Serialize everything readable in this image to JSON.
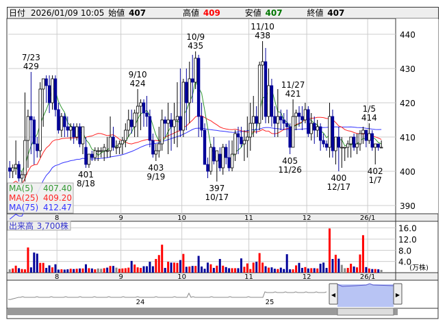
{
  "header": {
    "date_label": "日付",
    "datetime": "2026/01/09 10:05",
    "open_label": "始値",
    "open": "407",
    "high_label": "高値",
    "high": "409",
    "low_label": "安値",
    "low": "407",
    "close_label": "終値",
    "close": "407"
  },
  "colors": {
    "up_vol": "#ff0000",
    "down": "#000099",
    "flat": "#888888",
    "ma5": "#339933",
    "ma25": "#ff2222",
    "ma75": "#3333ff"
  },
  "legend": {
    "ma5_label": "MA(5)",
    "ma5": "407.40",
    "ma25_label": "MA(25)",
    "ma25": "409.20",
    "ma75_label": "MA(75)",
    "ma75": "412.47"
  },
  "volume_legend": {
    "label": "出来高",
    "value": "3,700株"
  },
  "navigator": {
    "labels": [
      "24",
      "25"
    ]
  },
  "chart_data": {
    "type": "candlestick",
    "ylim": [
      387,
      443
    ],
    "yticks": [
      390,
      400,
      410,
      420,
      430,
      440
    ],
    "volume_ylim": [
      0,
      18
    ],
    "volume_ticks": [
      "16.0",
      "12.0",
      "8.0",
      "4.0"
    ],
    "volume_unit": "(万株)",
    "months": [
      {
        "label": "8",
        "index": 16
      },
      {
        "label": "9",
        "index": 37
      },
      {
        "label": "10",
        "index": 57
      },
      {
        "label": "11",
        "index": 79
      },
      {
        "label": "12",
        "index": 98
      },
      {
        "label": "26/1",
        "index": 118
      }
    ],
    "annotations": [
      {
        "date": "7/23",
        "price": "429",
        "index": 7,
        "pos": "above"
      },
      {
        "date": "8/18",
        "price": "401",
        "index": 25,
        "pos": "below"
      },
      {
        "date": "9/10",
        "price": "424",
        "index": 42,
        "pos": "above"
      },
      {
        "date": "9/19",
        "price": "403",
        "index": 48,
        "pos": "below"
      },
      {
        "date": "10/9",
        "price": "435",
        "index": 61,
        "pos": "above"
      },
      {
        "date": "10/17",
        "price": "397",
        "index": 68,
        "pos": "below"
      },
      {
        "date": "11/10",
        "price": "438",
        "index": 83,
        "pos": "above"
      },
      {
        "date": "11/26",
        "price": "405",
        "index": 92,
        "pos": "below"
      },
      {
        "date": "11/27",
        "price": "421",
        "index": 93,
        "pos": "above"
      },
      {
        "date": "12/17",
        "price": "400",
        "index": 108,
        "pos": "below"
      },
      {
        "date": "1/5",
        "price": "414",
        "index": 118,
        "pos": "above"
      },
      {
        "date": "1/7",
        "price": "402",
        "index": 120,
        "pos": "below"
      }
    ],
    "ohlc": [
      [
        401,
        403,
        398,
        400
      ],
      [
        400,
        402,
        398,
        401
      ],
      [
        401,
        409,
        399,
        402
      ],
      [
        402,
        403,
        397,
        398
      ],
      [
        398,
        400,
        396,
        399
      ],
      [
        399,
        423,
        397,
        409
      ],
      [
        409,
        418,
        401,
        416
      ],
      [
        416,
        429,
        405,
        415
      ],
      [
        415,
        416,
        402,
        408
      ],
      [
        408,
        410,
        404,
        406
      ],
      [
        406,
        426,
        404,
        424
      ],
      [
        424,
        427,
        413,
        427
      ],
      [
        427,
        428,
        420,
        425
      ],
      [
        425,
        428,
        417,
        420
      ],
      [
        420,
        428,
        418,
        427
      ],
      [
        427,
        428,
        416,
        418
      ],
      [
        418,
        420,
        411,
        412
      ],
      [
        412,
        417,
        410,
        416
      ],
      [
        416,
        417,
        410,
        413
      ],
      [
        413,
        416,
        410,
        412
      ],
      [
        412,
        414,
        409,
        413
      ],
      [
        413,
        414,
        408,
        410
      ],
      [
        410,
        414,
        409,
        413
      ],
      [
        413,
        414,
        407,
        408
      ],
      [
        408,
        412,
        405,
        413
      ],
      [
        407,
        410,
        401,
        402
      ],
      [
        402,
        405,
        401,
        405
      ],
      [
        405,
        406,
        403,
        404
      ],
      [
        404,
        407,
        403,
        406
      ],
      [
        406,
        407,
        403,
        406
      ],
      [
        406,
        407,
        404,
        406
      ],
      [
        406,
        408,
        403,
        407
      ],
      [
        406,
        410,
        404,
        406
      ],
      [
        406,
        416,
        404,
        410
      ],
      [
        410,
        413,
        406,
        407
      ],
      [
        407,
        409,
        405,
        407
      ],
      [
        407,
        409,
        405,
        408
      ],
      [
        408,
        410,
        405,
        409
      ],
      [
        409,
        414,
        407,
        412
      ],
      [
        412,
        418,
        410,
        415
      ],
      [
        415,
        418,
        411,
        413
      ],
      [
        413,
        418,
        410,
        417
      ],
      [
        417,
        424,
        410,
        419
      ],
      [
        419,
        421,
        412,
        420
      ],
      [
        420,
        421,
        413,
        417
      ],
      [
        417,
        422,
        413,
        416
      ],
      [
        416,
        418,
        407,
        409
      ],
      [
        409,
        411,
        404,
        405
      ],
      [
        405,
        408,
        403,
        406
      ],
      [
        406,
        413,
        404,
        408
      ],
      [
        408,
        418,
        406,
        415
      ],
      [
        415,
        416,
        410,
        414
      ],
      [
        414,
        420,
        405,
        415
      ],
      [
        415,
        417,
        406,
        413
      ],
      [
        413,
        420,
        408,
        415
      ],
      [
        415,
        426,
        407,
        416
      ],
      [
        416,
        430,
        410,
        412
      ],
      [
        412,
        427,
        410,
        426
      ],
      [
        426,
        430,
        412,
        420
      ],
      [
        420,
        432,
        414,
        427
      ],
      [
        427,
        434,
        420,
        426
      ],
      [
        426,
        435,
        424,
        433
      ],
      [
        433,
        434,
        410,
        416
      ],
      [
        416,
        420,
        410,
        412
      ],
      [
        412,
        414,
        402,
        402
      ],
      [
        402,
        404,
        398,
        400
      ],
      [
        400,
        408,
        399,
        407
      ],
      [
        407,
        410,
        402,
        403
      ],
      [
        403,
        405,
        397,
        406
      ],
      [
        405,
        407,
        400,
        401
      ],
      [
        401,
        408,
        399,
        407
      ],
      [
        407,
        408,
        402,
        404
      ],
      [
        404,
        409,
        400,
        401
      ],
      [
        401,
        409,
        400,
        405
      ],
      [
        405,
        412,
        403,
        411
      ],
      [
        411,
        413,
        405,
        410
      ],
      [
        410,
        413,
        407,
        408
      ],
      [
        408,
        412,
        403,
        409
      ],
      [
        409,
        416,
        404,
        410
      ],
      [
        410,
        420,
        406,
        414
      ],
      [
        414,
        422,
        410,
        416
      ],
      [
        416,
        419,
        411,
        414
      ],
      [
        414,
        432,
        412,
        431
      ],
      [
        431,
        438,
        415,
        432
      ],
      [
        432,
        436,
        414,
        416
      ],
      [
        416,
        430,
        414,
        425
      ],
      [
        425,
        427,
        413,
        416
      ],
      [
        416,
        419,
        410,
        414
      ],
      [
        414,
        424,
        410,
        416
      ],
      [
        416,
        418,
        412,
        415
      ],
      [
        415,
        417,
        412,
        414
      ],
      [
        414,
        418,
        410,
        413
      ],
      [
        413,
        414,
        405,
        407
      ],
      [
        407,
        421,
        407,
        416
      ],
      [
        416,
        418,
        412,
        417
      ],
      [
        417,
        419,
        413,
        416
      ],
      [
        416,
        419,
        412,
        415
      ],
      [
        415,
        420,
        414,
        418
      ],
      [
        418,
        419,
        410,
        411
      ],
      [
        411,
        417,
        409,
        414
      ],
      [
        414,
        416,
        408,
        412
      ],
      [
        412,
        415,
        410,
        413
      ],
      [
        413,
        414,
        406,
        409
      ],
      [
        409,
        411,
        407,
        408
      ],
      [
        408,
        409,
        406,
        407
      ],
      [
        407,
        420,
        404,
        416
      ],
      [
        416,
        418,
        404,
        406
      ],
      [
        406,
        410,
        402,
        410
      ],
      [
        410,
        413,
        400,
        407
      ],
      [
        407,
        410,
        401,
        407
      ],
      [
        407,
        407,
        403,
        407
      ],
      [
        407,
        409,
        404,
        408
      ],
      [
        408,
        410,
        404,
        410
      ],
      [
        410,
        411,
        406,
        407
      ],
      [
        407,
        411,
        405,
        408
      ],
      [
        408,
        412,
        406,
        411
      ],
      [
        411,
        413,
        408,
        412
      ],
      [
        412,
        412,
        407,
        409
      ],
      [
        409,
        414,
        408,
        411
      ],
      [
        411,
        412,
        406,
        407
      ],
      [
        407,
        408,
        402,
        408
      ],
      [
        408,
        408,
        406,
        407
      ],
      [
        407,
        409,
        407,
        407
      ]
    ],
    "volume": [
      1.2,
      1.5,
      2.5,
      1.6,
      1.3,
      1.2,
      9.0,
      1.9,
      7.2,
      6.8,
      3.5,
      3.5,
      1.7,
      2.6,
      1.9,
      3.0,
      1.1,
      1.2,
      1.1,
      1.2,
      1.4,
      1.3,
      1.4,
      1.5,
      1.5,
      3.0,
      1.6,
      1.5,
      1.2,
      1.5,
      1.4,
      1.6,
      1.8,
      2.4,
      2.4,
      1.8,
      1.4,
      1.5,
      1.6,
      1.8,
      4.2,
      2.9,
      1.9,
      1.7,
      2.3,
      2.3,
      3.9,
      2.3,
      4.9,
      6.3,
      10.0,
      1.7,
      3.9,
      3.6,
      3.6,
      3.5,
      4.5,
      6.7,
      2.1,
      2.2,
      2.4,
      2.4,
      6.0,
      2.2,
      1.4,
      3.6,
      3.0,
      1.7,
      2.5,
      4.9,
      2.5,
      2.0,
      1.6,
      1.6,
      1.6,
      1.6,
      5.1,
      2.1,
      3.3,
      1.3,
      3.6,
      3.9,
      7.0,
      3.6,
      2.3,
      1.8,
      1.9,
      1.4,
      1.3,
      1.8,
      1.3,
      6.6,
      1.2,
      1.2,
      2.6,
      3.5,
      1.7,
      2.0,
      1.5,
      1.6,
      1.6,
      1.5,
      3.2,
      3.6,
      1.7,
      15.8,
      4.9,
      6.4,
      5.0,
      2.8,
      1.6,
      1.7,
      3.2,
      2.2,
      1.9,
      6.5,
      13.4,
      2.0,
      1.5,
      1.3,
      1.3,
      1.2,
      1.0
    ]
  }
}
